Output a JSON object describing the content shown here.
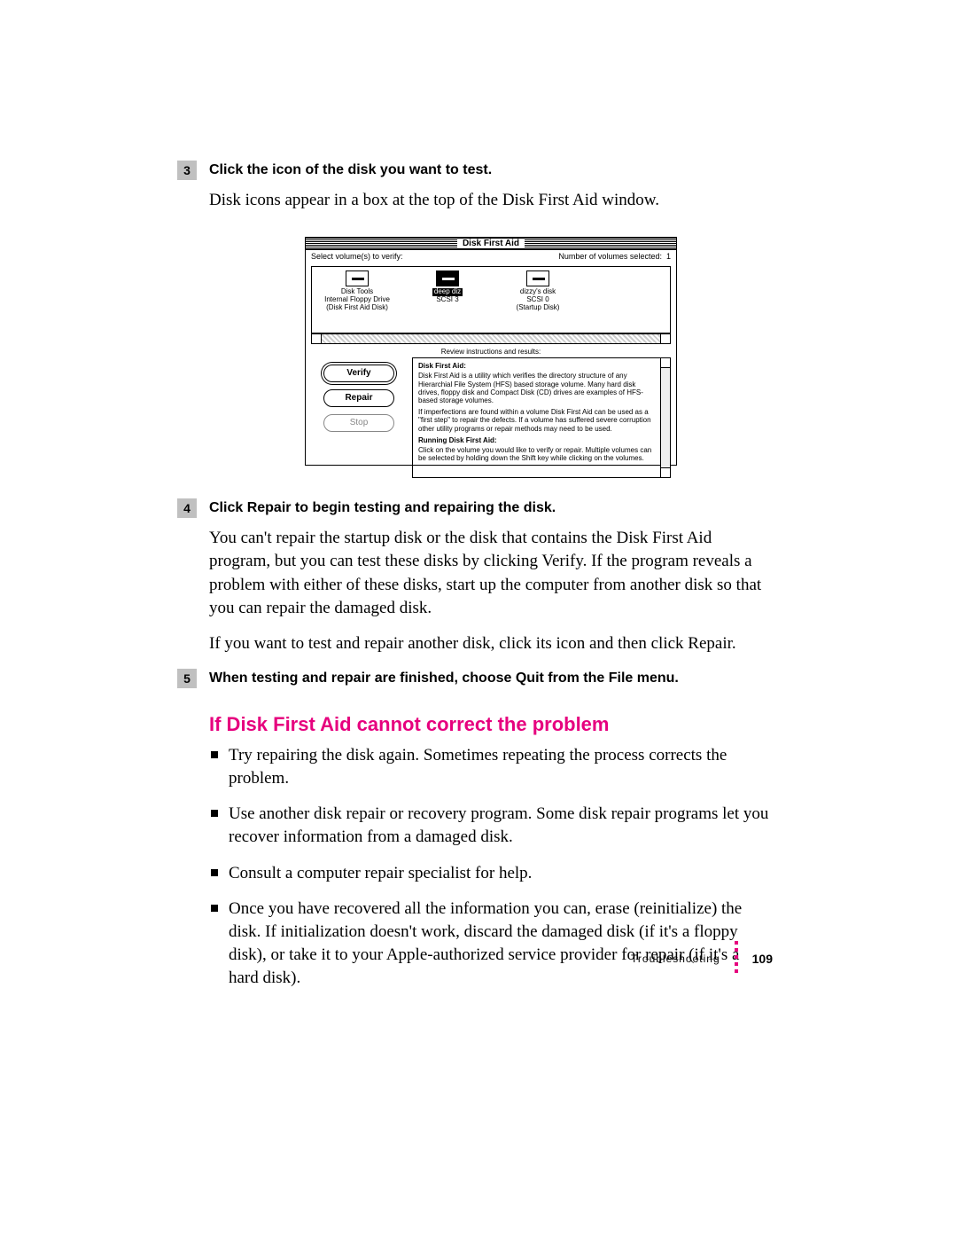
{
  "steps": {
    "s3": {
      "num": "3",
      "title": "Click the icon of the disk you want to test."
    },
    "s3_body": "Disk icons appear in a box at the top of the Disk First Aid window.",
    "s4": {
      "num": "4",
      "title": "Click Repair to begin testing and repairing the disk."
    },
    "s4_body1": "You can't repair the startup disk or the disk that contains the Disk First Aid program, but you can test these disks by clicking Verify. If the program reveals a problem with either of these disks, start up the computer from another disk so that you can repair the damaged disk.",
    "s4_body2": "If you want to test and repair another disk, click its icon and then click Repair.",
    "s5": {
      "num": "5",
      "title": "When testing and repair are finished, choose Quit from the File menu."
    }
  },
  "section_heading": "If Disk First Aid cannot correct the problem",
  "bullets": [
    "Try repairing the disk again. Sometimes repeating the process corrects the problem.",
    "Use another disk repair or recovery program. Some disk repair programs let you recover information from a damaged disk.",
    "Consult a computer repair specialist for help.",
    "Once you have recovered all the information you can, erase (reinitialize) the disk. If initialization doesn't work, discard the damaged disk (if it's a floppy disk), or take it to your Apple-authorized service provider for repair (if it's a hard disk)."
  ],
  "footer": {
    "section": "Troubleshooting",
    "page": "109"
  },
  "dfa": {
    "title": "Disk First Aid",
    "select_label": "Select volume(s) to verify:",
    "count_label": "Number of volumes selected:",
    "count_value": "1",
    "volumes": [
      {
        "name": "Disk Tools",
        "loc1": "Internal Floppy Drive",
        "loc2": "(Disk First Aid Disk)"
      },
      {
        "name": "deep diz",
        "loc1": "SCSI 3",
        "loc2": ""
      },
      {
        "name": "dizzy's disk",
        "loc1": "SCSI 0",
        "loc2": "(Startup Disk)"
      }
    ],
    "review_label": "Review instructions and results:",
    "buttons": {
      "verify": "Verify",
      "repair": "Repair",
      "stop": "Stop"
    },
    "results": {
      "h1": "Disk First Aid:",
      "p1": "Disk First Aid is a utility which verifies the directory structure of any Hierarchial File System (HFS) based storage volume. Many hard disk drives, floppy disk and Compact Disk (CD) drives are examples of HFS-based storage volumes.",
      "p2": "If imperfections are found within a volume Disk First Aid can be used as a \"first step\" to repair the defects. If a volume has suffered severe corruption other utility programs or repair methods may need to be used.",
      "h2": "Running Disk First Aid:",
      "p3": "Click on the volume you would like to verify or repair. Multiple volumes can be selected by holding down the Shift key while clicking on the volumes."
    }
  }
}
